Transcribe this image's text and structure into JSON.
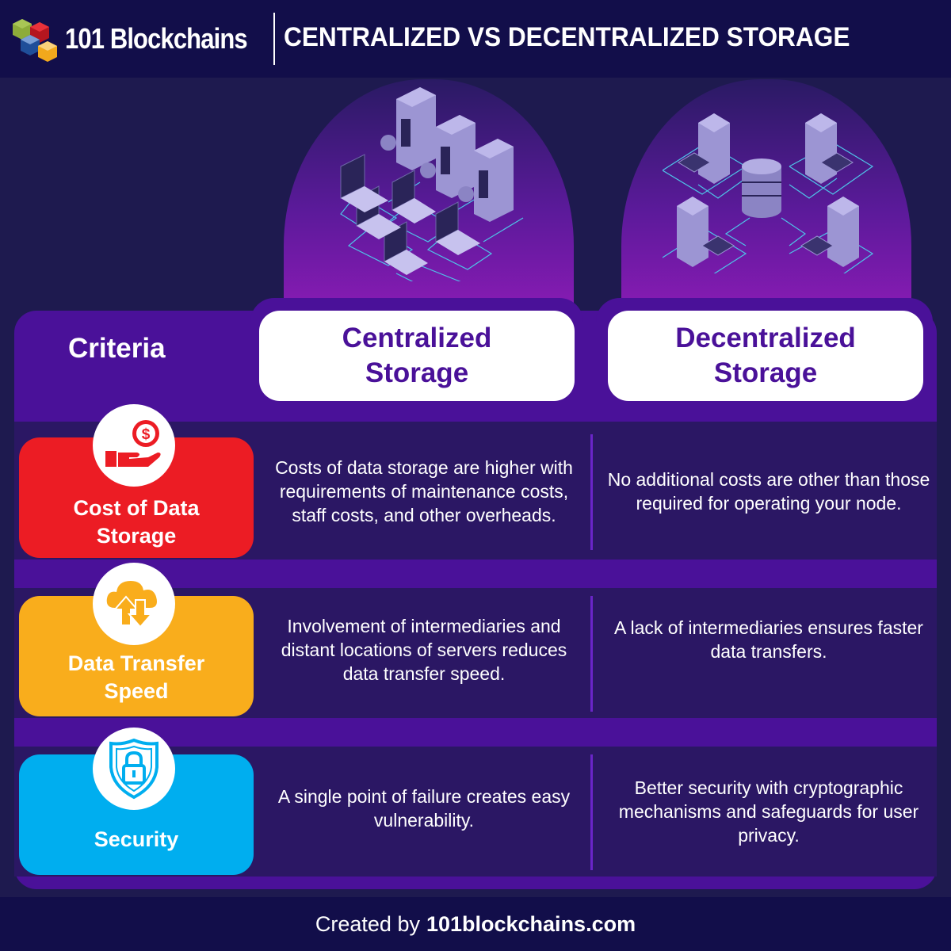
{
  "header": {
    "brand": "101 Blockchains",
    "title": "CENTRALIZED VS DECENTRALIZED STORAGE"
  },
  "colors": {
    "header_bg": "#120e4a",
    "panel_purple": "#4a1199",
    "row_bg": "#2b1764",
    "cost_red": "#ec1c24",
    "speed_orange": "#f9ad1c",
    "security_blue": "#00aeef"
  },
  "table": {
    "criteria_header": "Criteria",
    "columns": [
      {
        "label_line1": "Centralized",
        "label_line2": "Storage",
        "illustration": "centralized-servers-laptops-illustration"
      },
      {
        "label_line1": "Decentralized",
        "label_line2": "Storage",
        "illustration": "decentralized-database-network-illustration"
      }
    ],
    "rows": [
      {
        "criterion_line1": "Cost of Data",
        "criterion_line2": "Storage",
        "icon": "hand-dollar-coin-icon",
        "centralized": "Costs of data storage are higher with requirements of maintenance costs, staff costs, and other overheads.",
        "decentralized": "No additional costs are other than those required for operating your node."
      },
      {
        "criterion_line1": "Data Transfer",
        "criterion_line2": "Speed",
        "icon": "cloud-upload-download-icon",
        "centralized": "Involvement of intermediaries and distant locations of servers reduces data transfer speed.",
        "decentralized": "A lack of intermediaries ensures faster data transfers."
      },
      {
        "criterion_line1": "Security",
        "criterion_line2": "",
        "icon": "shield-lock-icon",
        "centralized": "A single point of failure creates easy vulnerability.",
        "decentralized": "Better security with cryptographic mechanisms and safeguards for user privacy."
      }
    ]
  },
  "footer": {
    "prefix": "Created by",
    "site": "101blockchains.com"
  }
}
